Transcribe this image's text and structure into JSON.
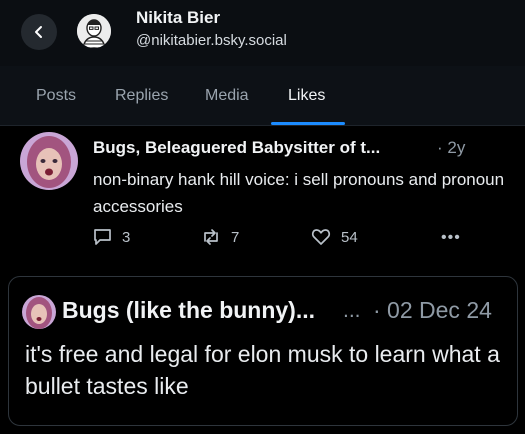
{
  "profile": {
    "name": "Nikita Bier",
    "handle": "@nikitabier.bsky.social"
  },
  "tabs": [
    {
      "label": "Posts",
      "active": false
    },
    {
      "label": "Replies",
      "active": false
    },
    {
      "label": "Media",
      "active": false
    },
    {
      "label": "Likes",
      "active": true
    }
  ],
  "post": {
    "author": "Bugs, Beleaguered Babysitter of t...",
    "time": "· 2y",
    "text": "non-binary hank hill voice: i sell pronouns and pronoun accessories",
    "replies": "3",
    "reposts": "7",
    "likes": "54",
    "more": "•••"
  },
  "quote": {
    "author": "Bugs (like the bunny)...",
    "ellipsis": "...",
    "date": "· 02 Dec 24",
    "text": "it's free and legal for elon musk to learn what a bullet tastes like"
  },
  "colors": {
    "accent": "#1c8cff",
    "background": "#000000",
    "header": "#0b0e12"
  },
  "icons": [
    "chevron-left-icon",
    "reply-icon",
    "repost-icon",
    "heart-icon",
    "more-icon"
  ]
}
